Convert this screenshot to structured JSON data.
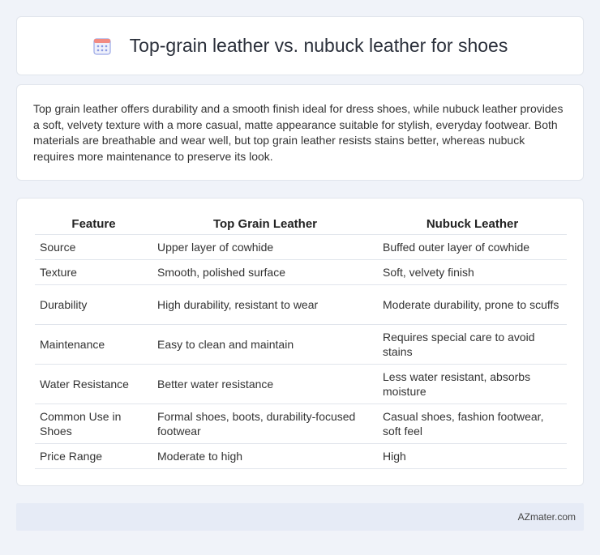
{
  "header": {
    "icon": "calendar-icon",
    "title": "Top-grain leather vs. nubuck leather for shoes"
  },
  "summary": {
    "text": "Top grain leather offers durability and a smooth finish ideal for dress shoes, while nubuck leather provides a soft, velvety texture with a more casual, matte appearance suitable for stylish, everyday footwear. Both materials are breathable and wear well, but top grain leather resists stains better, whereas nubuck requires more maintenance to preserve its look."
  },
  "table": {
    "headers": [
      "Feature",
      "Top Grain Leather",
      "Nubuck Leather"
    ],
    "rows": [
      [
        "Source",
        "Upper layer of cowhide",
        "Buffed outer layer of cowhide"
      ],
      [
        "Texture",
        "Smooth, polished surface",
        "Soft, velvety finish"
      ],
      [
        "Durability",
        "High durability, resistant to wear",
        "Moderate durability, prone to scuffs"
      ],
      [
        "Maintenance",
        "Easy to clean and maintain",
        "Requires special care to avoid stains"
      ],
      [
        "Water Resistance",
        "Better water resistance",
        "Less water resistant, absorbs moisture"
      ],
      [
        "Common Use in Shoes",
        "Formal shoes, boots, durability-focused footwear",
        "Casual shoes, fashion footwear, soft feel"
      ],
      [
        "Price Range",
        "Moderate to high",
        "High"
      ]
    ]
  },
  "footer": {
    "text": "AZmater.com"
  },
  "colors": {
    "background": "#f0f3f9",
    "card": "#ffffff",
    "border": "#e1e5ec",
    "footer": "#e6ebf6",
    "icon_accent": "#7b8fe0"
  }
}
